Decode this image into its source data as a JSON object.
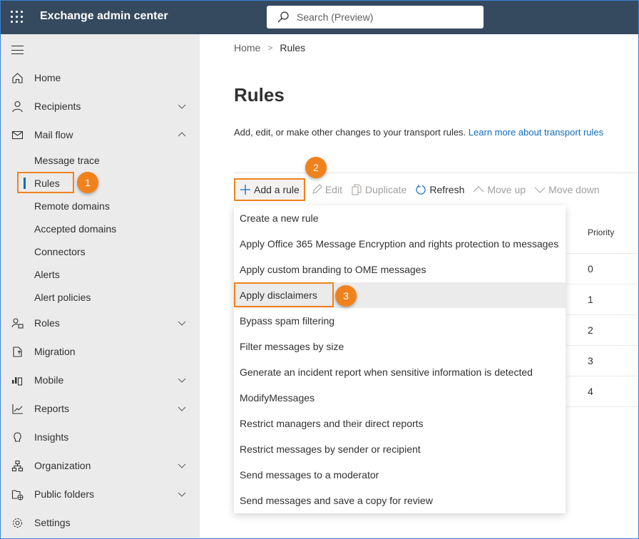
{
  "header": {
    "app_title": "Exchange admin center",
    "search_placeholder": "Search (Preview)"
  },
  "sidebar": {
    "items": [
      {
        "label": "Home",
        "icon": "home-icon",
        "expandable": false
      },
      {
        "label": "Recipients",
        "icon": "person-icon",
        "expandable": true,
        "expanded": false
      },
      {
        "label": "Mail flow",
        "icon": "mail-icon",
        "expandable": true,
        "expanded": true
      },
      {
        "label": "Roles",
        "icon": "roles-icon",
        "expandable": true,
        "expanded": false
      },
      {
        "label": "Migration",
        "icon": "migration-icon",
        "expandable": false
      },
      {
        "label": "Mobile",
        "icon": "mobile-icon",
        "expandable": true,
        "expanded": false
      },
      {
        "label": "Reports",
        "icon": "chart-icon",
        "expandable": true,
        "expanded": false
      },
      {
        "label": "Insights",
        "icon": "lightbulb-icon",
        "expandable": false
      },
      {
        "label": "Organization",
        "icon": "org-icon",
        "expandable": true,
        "expanded": false
      },
      {
        "label": "Public folders",
        "icon": "public-folder-icon",
        "expandable": true,
        "expanded": false
      },
      {
        "label": "Settings",
        "icon": "gear-icon",
        "expandable": false
      }
    ],
    "mail_flow_subitems": [
      {
        "label": "Message trace"
      },
      {
        "label": "Rules",
        "selected": true
      },
      {
        "label": "Remote domains"
      },
      {
        "label": "Accepted domains"
      },
      {
        "label": "Connectors"
      },
      {
        "label": "Alerts"
      },
      {
        "label": "Alert policies"
      }
    ]
  },
  "breadcrumb": {
    "home": "Home",
    "current": "Rules"
  },
  "page": {
    "title": "Rules",
    "description": "Add, edit, or make other changes to your transport rules.",
    "learn_more": "Learn more about transport rules"
  },
  "toolbar": {
    "add": "Add a rule",
    "edit": "Edit",
    "duplicate": "Duplicate",
    "refresh": "Refresh",
    "move_up": "Move up",
    "move_down": "Move down"
  },
  "table": {
    "priority_header": "Priority",
    "priorities": [
      "0",
      "1",
      "2",
      "3",
      "4"
    ]
  },
  "dropdown": {
    "items": [
      "Create a new rule",
      "Apply Office 365 Message Encryption and rights protection to messages",
      "Apply custom branding to OME messages",
      "Apply disclaimers",
      "Bypass spam filtering",
      "Filter messages by size",
      "Generate an incident report when sensitive information is detected",
      "ModifyMessages",
      "Restrict managers and their direct reports",
      "Restrict messages by sender or recipient",
      "Send messages to a moderator",
      "Send messages and save a copy for review"
    ],
    "hovered_index": 3
  },
  "annotations": {
    "step1": "1",
    "step2": "2",
    "step3": "3",
    "color": "#f0821e"
  }
}
